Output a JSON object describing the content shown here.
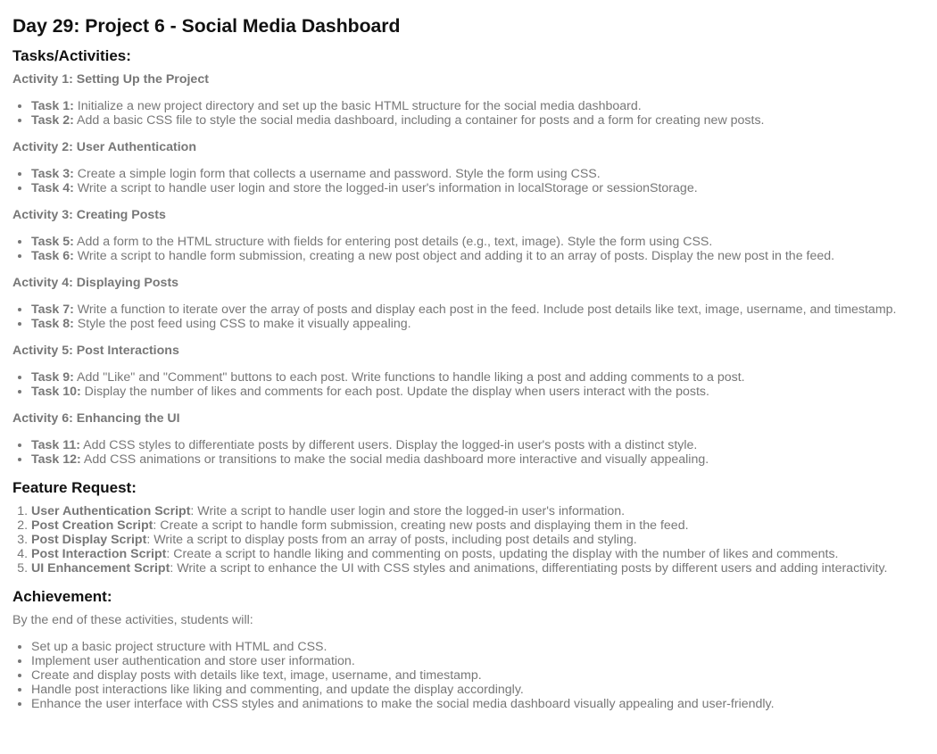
{
  "title": "Day 29: Project 6 - Social Media Dashboard",
  "tasks_heading": "Tasks/Activities:",
  "activities": [
    {
      "heading": "Activity 1: Setting Up the Project",
      "tasks": [
        {
          "label": "Task 1:",
          "text": " Initialize a new project directory and set up the basic HTML structure for the social media dashboard."
        },
        {
          "label": "Task 2:",
          "text": " Add a basic CSS file to style the social media dashboard, including a container for posts and a form for creating new posts."
        }
      ]
    },
    {
      "heading": "Activity 2: User Authentication",
      "tasks": [
        {
          "label": "Task 3:",
          "text": " Create a simple login form that collects a username and password. Style the form using CSS."
        },
        {
          "label": "Task 4:",
          "text": " Write a script to handle user login and store the logged-in user's information in localStorage or sessionStorage."
        }
      ]
    },
    {
      "heading": "Activity 3: Creating Posts",
      "tasks": [
        {
          "label": "Task 5:",
          "text": " Add a form to the HTML structure with fields for entering post details (e.g., text, image). Style the form using CSS."
        },
        {
          "label": "Task 6:",
          "text": " Write a script to handle form submission, creating a new post object and adding it to an array of posts. Display the new post in the feed."
        }
      ]
    },
    {
      "heading": "Activity 4: Displaying Posts",
      "tasks": [
        {
          "label": "Task 7:",
          "text": " Write a function to iterate over the array of posts and display each post in the feed. Include post details like text, image, username, and timestamp."
        },
        {
          "label": "Task 8:",
          "text": " Style the post feed using CSS to make it visually appealing."
        }
      ]
    },
    {
      "heading": "Activity 5: Post Interactions",
      "tasks": [
        {
          "label": "Task 9:",
          "text": " Add \"Like\" and \"Comment\" buttons to each post. Write functions to handle liking a post and adding comments to a post."
        },
        {
          "label": "Task 10:",
          "text": " Display the number of likes and comments for each post. Update the display when users interact with the posts."
        }
      ]
    },
    {
      "heading": "Activity 6: Enhancing the UI",
      "tasks": [
        {
          "label": "Task 11:",
          "text": " Add CSS styles to differentiate posts by different users. Display the logged-in user's posts with a distinct style."
        },
        {
          "label": "Task 12:",
          "text": " Add CSS animations or transitions to make the social media dashboard more interactive and visually appealing."
        }
      ]
    }
  ],
  "feature_heading": "Feature Request:",
  "features": [
    {
      "label": "User Authentication Script",
      "text": ": Write a script to handle user login and store the logged-in user's information."
    },
    {
      "label": "Post Creation Script",
      "text": ": Create a script to handle form submission, creating new posts and displaying them in the feed."
    },
    {
      "label": "Post Display Script",
      "text": ": Write a script to display posts from an array of posts, including post details and styling."
    },
    {
      "label": "Post Interaction Script",
      "text": ": Create a script to handle liking and commenting on posts, updating the display with the number of likes and comments."
    },
    {
      "label": "UI Enhancement Script",
      "text": ": Write a script to enhance the UI with CSS styles and animations, differentiating posts by different users and adding interactivity."
    }
  ],
  "achievement_heading": "Achievement:",
  "achievement_intro": "By the end of these activities, students will:",
  "achievements": [
    "Set up a basic project structure with HTML and CSS.",
    "Implement user authentication and store user information.",
    "Create and display posts with details like text, image, username, and timestamp.",
    "Handle post interactions like liking and commenting, and update the display accordingly.",
    "Enhance the user interface with CSS styles and animations to make the social media dashboard visually appealing and user-friendly."
  ]
}
